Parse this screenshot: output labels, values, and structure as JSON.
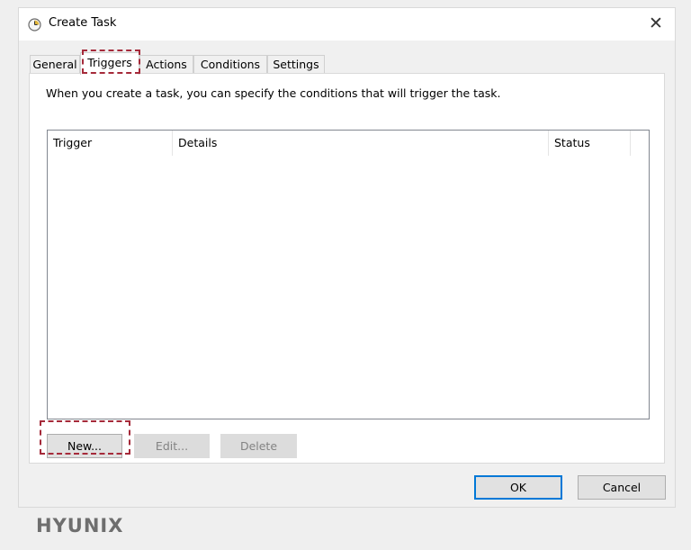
{
  "window": {
    "title": "Create Task",
    "title_icon": "task-scheduler-clock-icon",
    "close_glyph": "✕"
  },
  "tabs": [
    {
      "label": "General",
      "active": false
    },
    {
      "label": "Triggers",
      "active": true
    },
    {
      "label": "Actions",
      "active": false
    },
    {
      "label": "Conditions",
      "active": false
    },
    {
      "label": "Settings",
      "active": false
    }
  ],
  "triggers_panel": {
    "instruction": "When you create a task, you can specify the conditions that will trigger the task.",
    "columns": [
      "Trigger",
      "Details",
      "Status"
    ],
    "rows": [],
    "buttons": {
      "new": "New...",
      "edit": "Edit...",
      "delete": "Delete"
    }
  },
  "footer": {
    "ok": "OK",
    "cancel": "Cancel"
  },
  "watermark": {
    "text": "HYUNIX"
  },
  "colors": {
    "highlight": "#a52a3a",
    "default_button_border": "#0078d7",
    "background": "#f0f0f0"
  }
}
